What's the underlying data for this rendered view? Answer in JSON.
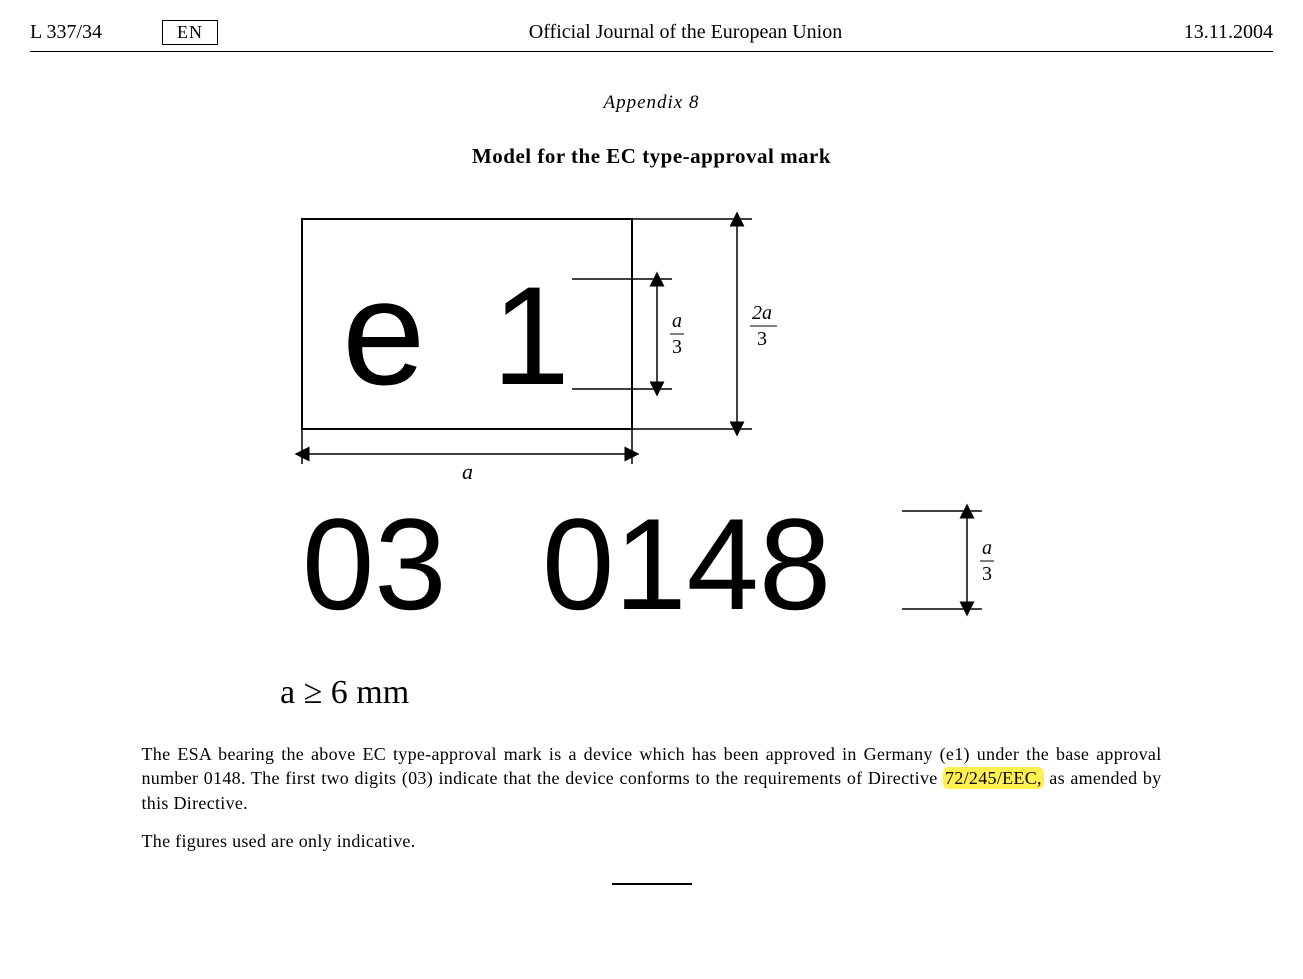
{
  "header": {
    "page_ref": "L  337/34",
    "lang": "EN",
    "journal": "Official Journal of the European Union",
    "date": "13.11.2004"
  },
  "appendix_label": "Appendix  8",
  "title": "Model  for  the  EC  type-approval  mark",
  "diagram": {
    "mark_letter": "e",
    "mark_country": "1",
    "approval_number_part1": "03",
    "approval_number_part2": "0148",
    "dim_a": "a",
    "dim_a_over_3_top": "a",
    "dim_a_over_3_bot": "3",
    "dim_2a_over_3_top": "2a",
    "dim_2a_over_3_bot": "3"
  },
  "constraint": "a ≥ 6 mm",
  "paragraph1_pre": "The ESA bearing the above EC type-approval mark is a device which has been approved in Germany (e1) under the base approval number 0148. The first two digits (03) indicate that the device conforms to the requirements of Directive ",
  "paragraph1_highlight": "72/245/EEC,",
  "paragraph1_post": " as amended by this Directive.",
  "paragraph2": "The figures used are only indicative."
}
